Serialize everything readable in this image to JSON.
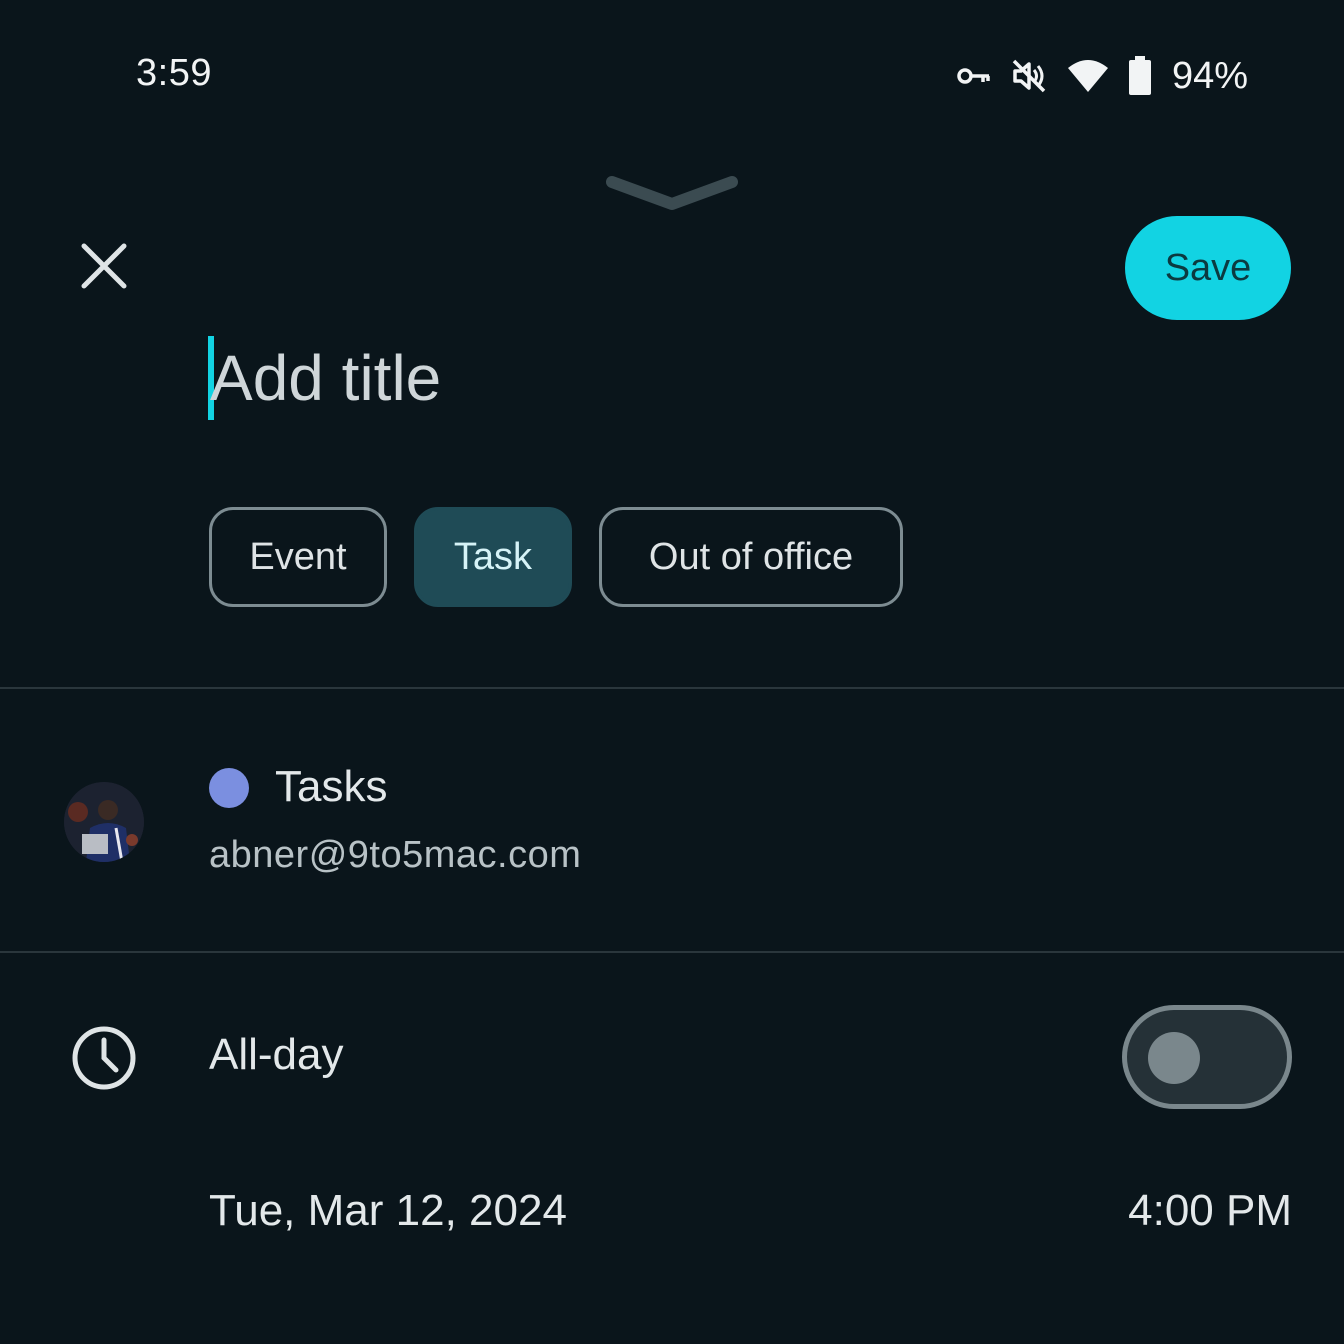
{
  "status_bar": {
    "time": "3:59",
    "battery_percent": "94%",
    "icons": [
      "vpn-key-icon",
      "vibrate-off-icon",
      "wifi-icon",
      "battery-icon"
    ]
  },
  "header": {
    "close_icon": "close-icon",
    "save_label": "Save"
  },
  "title": {
    "placeholder": "Add title",
    "value": ""
  },
  "type_chips": [
    {
      "label": "Event",
      "selected": false
    },
    {
      "label": "Task",
      "selected": true
    },
    {
      "label": "Out of office",
      "selected": false
    }
  ],
  "calendar": {
    "name": "Tasks",
    "account": "abner@9to5mac.com",
    "color": "#7b8fe0"
  },
  "all_day": {
    "label": "All-day",
    "enabled": false
  },
  "schedule": {
    "date": "Tue, Mar 12, 2024",
    "time": "4:00 PM"
  },
  "colors": {
    "background": "#0a151b",
    "accent": "#12d3e3",
    "selected_chip": "#1f4b56"
  }
}
